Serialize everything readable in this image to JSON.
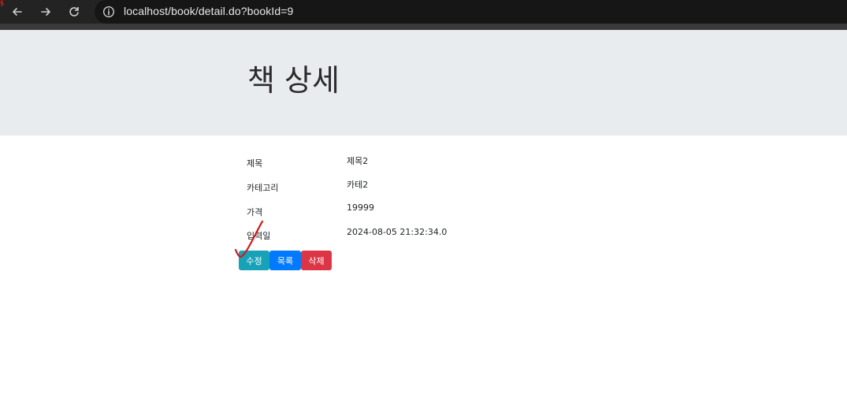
{
  "browser": {
    "url": "localhost/book/detail.do?bookId=9"
  },
  "page": {
    "title": "책 상세"
  },
  "details": [
    {
      "label": "제목",
      "value": "제목2"
    },
    {
      "label": "카테고리",
      "value": "카테2"
    },
    {
      "label": "가격",
      "value": "19999"
    },
    {
      "label": "입력일",
      "value": "2024-08-05 21:32:34.0"
    }
  ],
  "buttons": {
    "edit": "수정",
    "list": "목록",
    "delete": "삭제"
  },
  "colors": {
    "jumbotron": "#e9ecef",
    "edit_button": "#17a2b8",
    "list_button": "#007bff",
    "delete_button": "#dc3545",
    "annotation": "#d11a1a"
  }
}
